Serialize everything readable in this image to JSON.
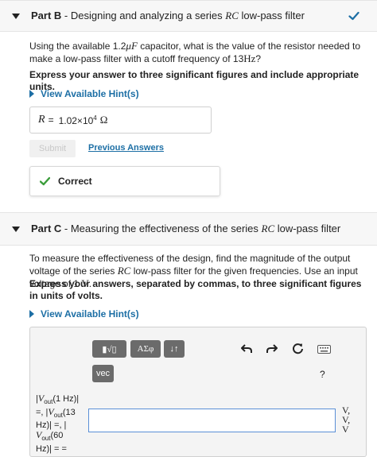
{
  "partB": {
    "label": "Part B",
    "title_pre": " - Designing and analyzing a series ",
    "title_rc": "RC",
    "title_post": " low-pass filter",
    "q1": "Using the available 1.2",
    "q_cap": "μF",
    "q2": " capacitor, what is the value of the resistor needed to make a low-pass filter with a cutoff frequency of 13",
    "q_hz": "Hz",
    "q3": "?",
    "instruction": "Express your answer to three significant figures and include appropriate units.",
    "hint_label": "View Available Hint(s)",
    "answer_var": "R",
    "answer_eq": "=",
    "answer_mant": "1.02×10",
    "answer_exp": "4",
    "answer_unit": "Ω",
    "submit_label": "Submit",
    "prev_label": "Previous Answers",
    "correct_label": "Correct"
  },
  "partC": {
    "label": "Part C",
    "title": " - Measuring the effectiveness of the series ",
    "title_rc": "RC",
    "title_post": " low-pass filter",
    "q1": "To measure the effectiveness of the design, find the magnitude of the output voltage of the series ",
    "q_rc": "RC",
    "q2": " low-pass filter for the given frequencies. Use an input voltage of 1 ",
    "q_v": "V",
    "q3": ".",
    "instruction": "Express your answers, separated by commas, to three significant figures in units of volts.",
    "hint_label": "View Available Hint(s)",
    "toolbar": {
      "templates_label": "▮√▯",
      "greek_label": "ΑΣφ",
      "sort_label": "↓↑",
      "vec_label": "vec",
      "help_label": "?"
    },
    "lhs_1a": "|",
    "lhs_V": "V",
    "lhs_out": "out",
    "lhs_1b": "(1 Hz)|",
    "lhs_2a": "=, |",
    "lhs_2b": "(13",
    "lhs_3": "Hz)| =, |",
    "lhs_4b": "(60",
    "lhs_5": "Hz)| = =",
    "units": [
      "V,",
      "V,",
      "V"
    ],
    "input_value": ""
  },
  "icons": [
    "check-icon",
    "undo-icon",
    "redo-icon",
    "reset-icon",
    "keyboard-icon",
    "caret-down-icon",
    "hint-arrow-icon"
  ],
  "colors": {
    "link": "#1d6fa5",
    "correct": "#3a9d3a",
    "toolbar_btn": "#6b6b6b"
  }
}
